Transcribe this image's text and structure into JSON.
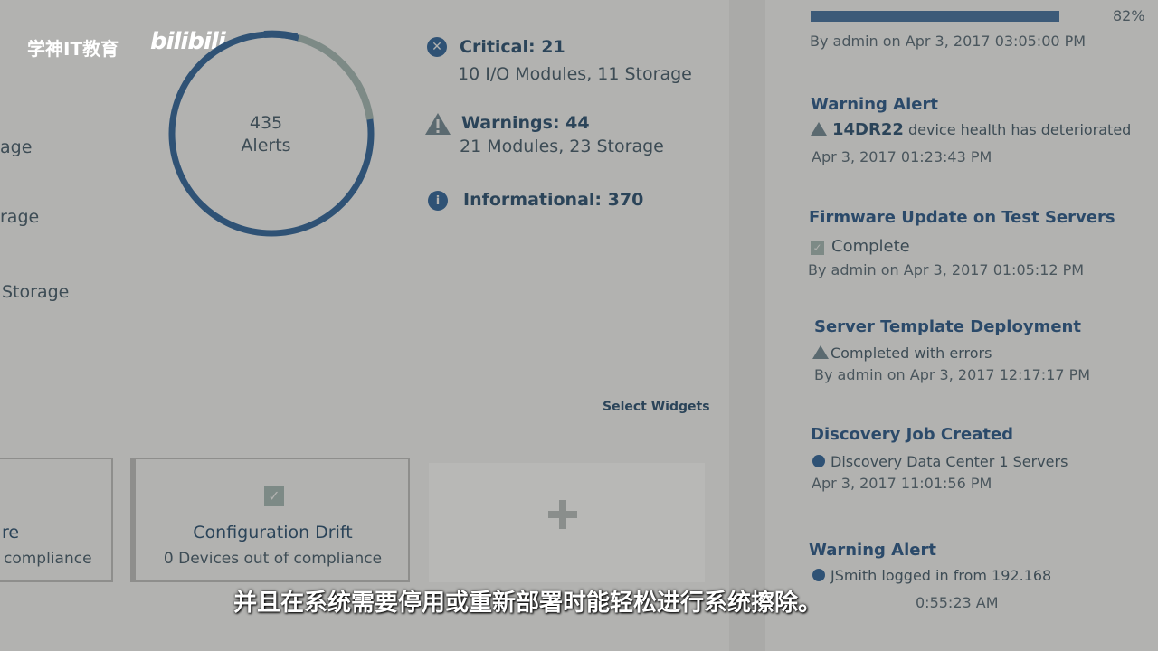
{
  "watermark": {
    "brand": "学神IT教育",
    "logo": "bilibili"
  },
  "left_partial_labels": [
    "age",
    "rage",
    "Storage"
  ],
  "alerts": {
    "donut": {
      "count": "435",
      "label": "Alerts"
    },
    "critical": {
      "title": "Critical: 21",
      "detail": "10 I/O Modules, 11 Storage",
      "icon": "x-circle-icon"
    },
    "warnings": {
      "title": "Warnings: 44",
      "detail": "21 Modules, 23 Storage",
      "icon": "warning-triangle-icon"
    },
    "informational": {
      "title": "Informational: 370",
      "icon": "info-circle-icon"
    },
    "colors": {
      "critical": "#2f5275",
      "warning": "#7d8a86",
      "ring": "#2f5275"
    }
  },
  "select_widgets": "Select Widgets",
  "widgets": [
    {
      "title": "re",
      "subtitle": "compliance"
    },
    {
      "title": "Configuration Drift",
      "subtitle": "0 Devices out of compliance",
      "icon": "checkbox-icon"
    },
    {
      "title": "",
      "icon": "plus-icon"
    }
  ],
  "activity": {
    "progress": {
      "percent_label": "82%",
      "fill": 0.82,
      "meta": "By admin on Apr 3, 2017 03:05:00 PM"
    },
    "items": [
      {
        "title": "Warning Alert",
        "line": "device health has deteriorated",
        "line_bold": "14DR22",
        "icon": "warning-triangle-icon",
        "meta": "Apr 3, 2017 01:23:43 PM"
      },
      {
        "title": "Firmware Update on Test Servers",
        "line": "Complete",
        "icon": "checkbox-icon",
        "meta": "By admin on Apr 3, 2017 01:05:12 PM"
      },
      {
        "title": "Server Template Deployment",
        "line": "Completed with errors",
        "icon": "warning-triangle-icon",
        "meta": "By admin on Apr 3, 2017 12:17:17 PM"
      },
      {
        "title": "Discovery Job Created",
        "line": "Discovery Data Center 1 Servers",
        "icon": "info-dot-icon",
        "meta": "Apr 3, 2017 11:01:56 PM"
      },
      {
        "title": "Warning Alert",
        "line": "JSmith logged in from 192.168",
        "icon": "info-dot-icon",
        "meta": "0:55:23 AM"
      }
    ]
  },
  "subtitle": "并且在系统需要停用或重新部署时能轻松进行系统擦除。"
}
